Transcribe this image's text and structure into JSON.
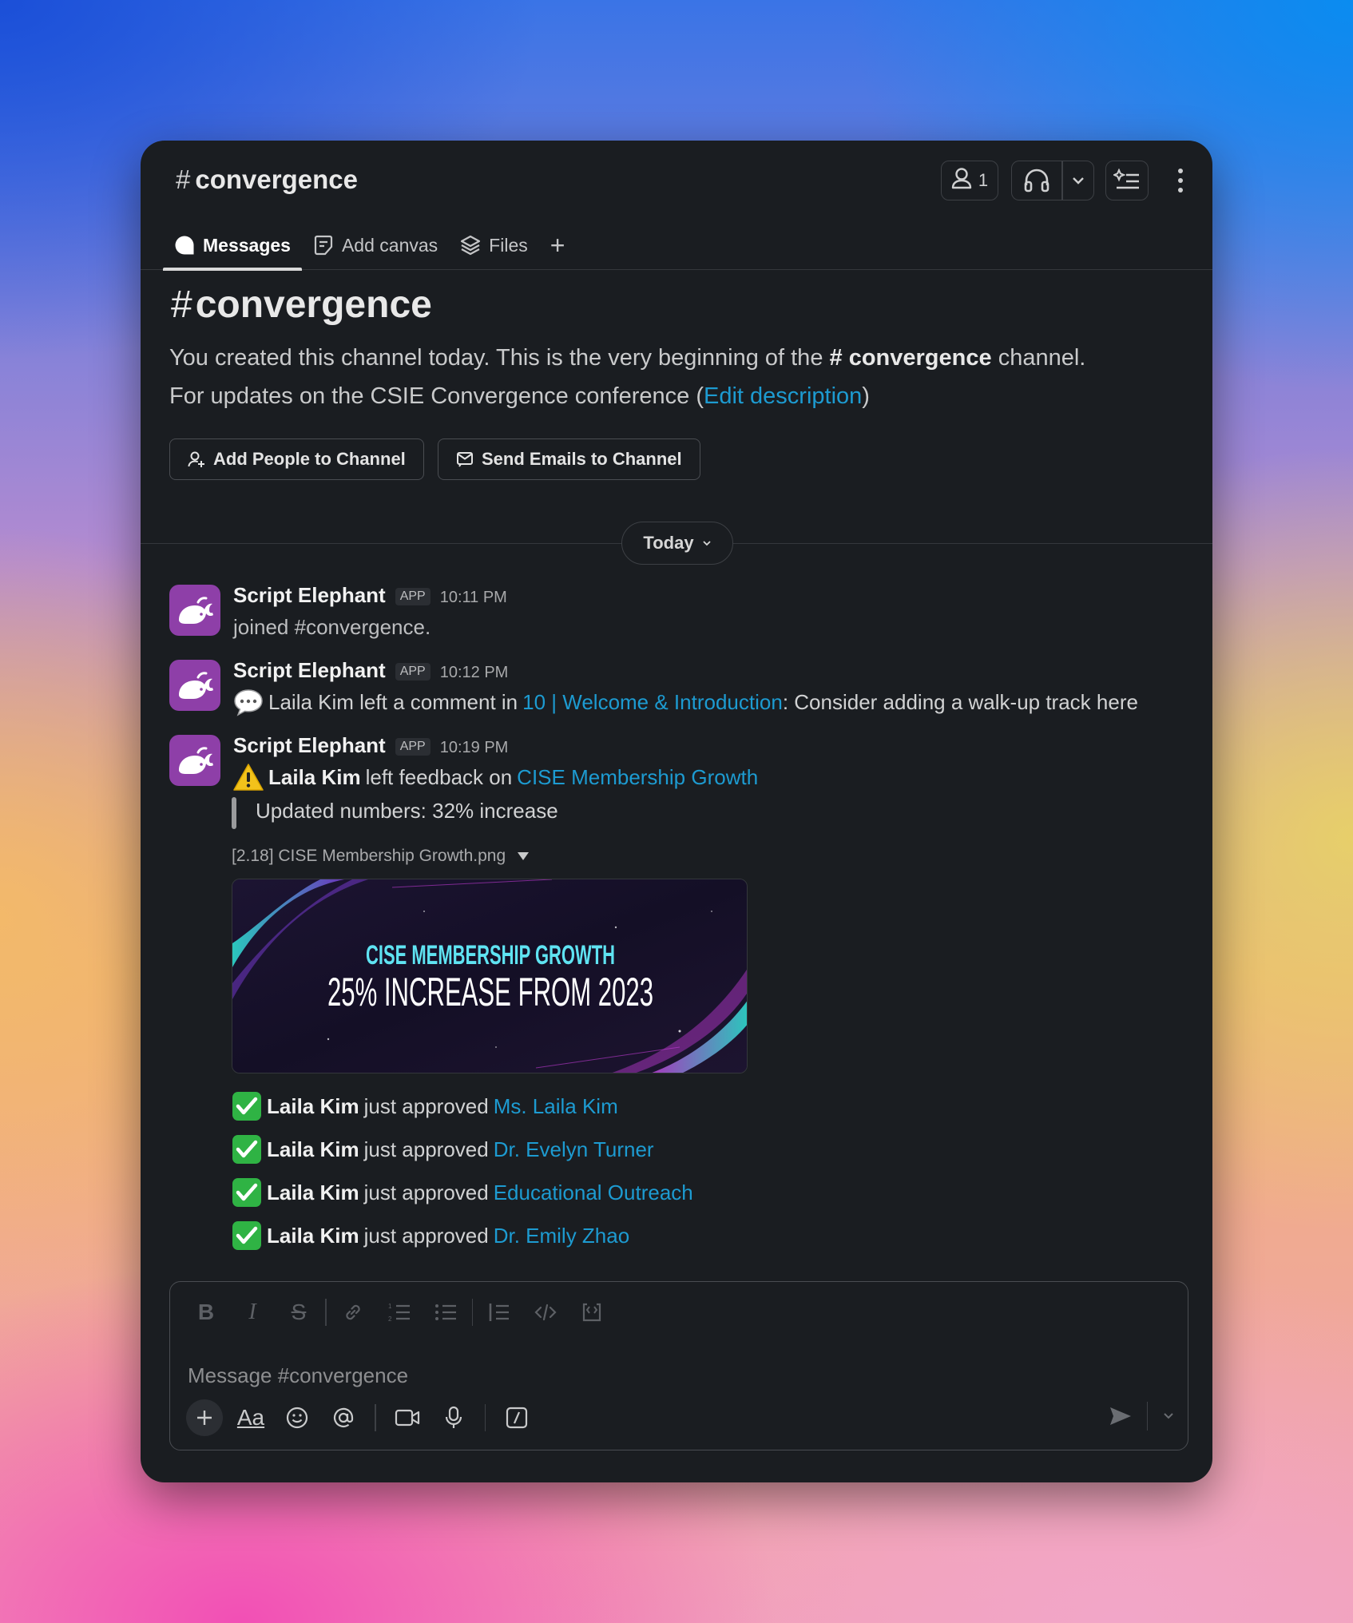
{
  "header": {
    "channel_hash": "#",
    "channel_name": "convergence",
    "member_count": "1"
  },
  "tabs": [
    {
      "label": "Messages"
    },
    {
      "label": "Add canvas"
    },
    {
      "label": "Files"
    }
  ],
  "intro": {
    "hash": "#",
    "title": "convergence",
    "line1_pre": "You created this channel today. This is the very beginning of the",
    "line1_channel": "# convergence",
    "line1_post": "channel.",
    "line2_pre": "For updates on the CSIE Convergence conference (",
    "edit_link": "Edit description",
    "line2_post": ")",
    "add_people_label": "Add People to Channel",
    "send_emails_label": "Send Emails to Channel"
  },
  "divider_label": "Today",
  "messages": [
    {
      "sender": "Script Elephant",
      "badge": "APP",
      "time": "10:11 PM",
      "text": "joined #convergence."
    },
    {
      "sender": "Script Elephant",
      "badge": "APP",
      "time": "10:12 PM",
      "text_pre": "Laila Kim left a comment in",
      "link": "10 | Welcome & Introduction",
      "text_post": ": Consider adding a walk-up track here"
    },
    {
      "sender": "Script Elephant",
      "badge": "APP",
      "time": "10:19 PM",
      "actor": "Laila Kim",
      "text_mid": "left feedback on",
      "link": "CISE Membership Growth",
      "quote": "Updated numbers: 32% increase",
      "file_name": "[2.18] CISE Membership Growth.png",
      "image_title": "CISE MEMBERSHIP GROWTH",
      "image_subtitle": "25% INCREASE FROM 2023",
      "approvals": [
        {
          "actor": "Laila Kim",
          "verb": "just approved",
          "target": "Ms. Laila Kim"
        },
        {
          "actor": "Laila Kim",
          "verb": "just approved",
          "target": "Dr. Evelyn Turner"
        },
        {
          "actor": "Laila Kim",
          "verb": "just approved",
          "target": "Educational Outreach"
        },
        {
          "actor": "Laila Kim",
          "verb": "just approved",
          "target": "Dr. Emily Zhao"
        }
      ]
    }
  ],
  "composer": {
    "placeholder": "Message #convergence",
    "format_label": "Aa"
  },
  "colors": {
    "window_bg": "#1a1d21",
    "link": "#1d9bd1",
    "avatar": "#8e3fa8",
    "approve_green": "#2fb344",
    "warning_yellow": "#f2c21b"
  }
}
